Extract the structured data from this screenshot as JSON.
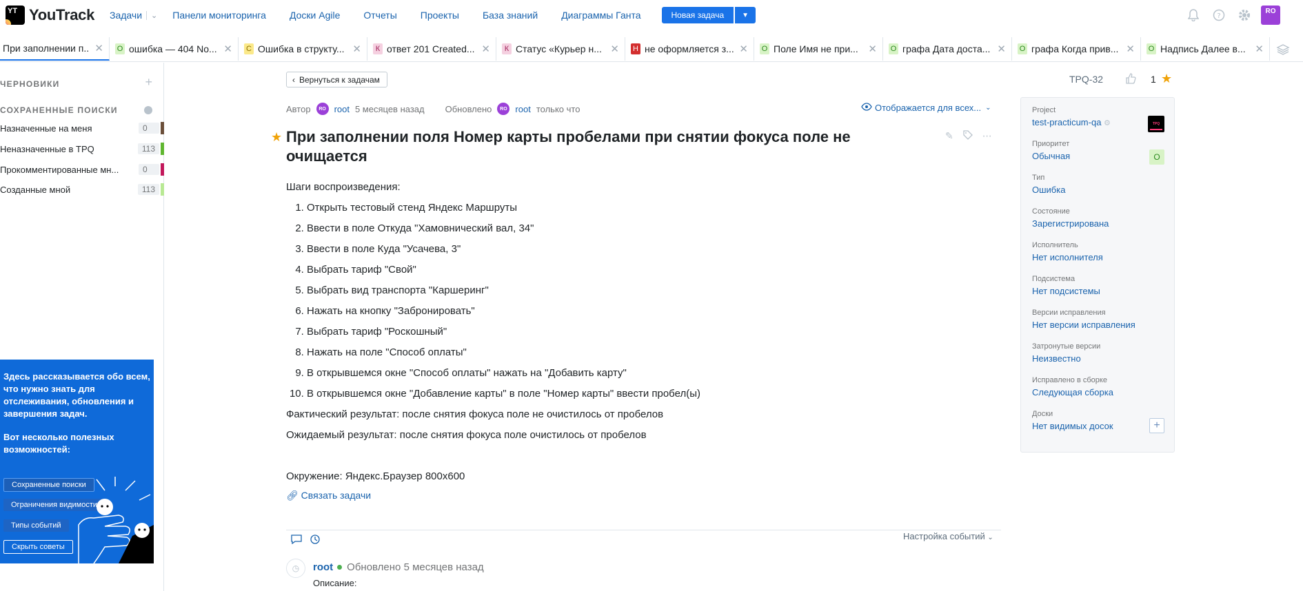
{
  "header": {
    "brand": "YouTrack",
    "logo_text": "YT",
    "nav": [
      "Задачи",
      "Панели мониторинга",
      "Доски Agile",
      "Отчеты",
      "Проекты",
      "База знаний",
      "Диаграммы Ганта"
    ],
    "new_issue": "Новая задача",
    "avatar": "RO"
  },
  "tabs": [
    {
      "type": "",
      "type_color": "",
      "label": "При заполнении п..."
    },
    {
      "type": "О",
      "type_color": "#d8f3c6",
      "label": "ошибка — 404 No..."
    },
    {
      "type": "С",
      "type_color": "#fbe98a",
      "label": "Ошибка в структу..."
    },
    {
      "type": "К",
      "type_color": "#f5d0e0",
      "label": "ответ 201 Created..."
    },
    {
      "type": "К",
      "type_color": "#f5d0e0",
      "label": "Статус «Курьер н..."
    },
    {
      "type": "Н",
      "type_color": "#d32f2f",
      "label": "не оформляется з..."
    },
    {
      "type": "О",
      "type_color": "#d8f3c6",
      "label": "Поле Имя не при..."
    },
    {
      "type": "О",
      "type_color": "#d8f3c6",
      "label": "графа Дата доста..."
    },
    {
      "type": "О",
      "type_color": "#d8f3c6",
      "label": "графа Когда прив..."
    },
    {
      "type": "О",
      "type_color": "#d8f3c6",
      "label": "Надпись Далее в..."
    }
  ],
  "sidebar": {
    "drafts": "ЧЕРНОВИКИ",
    "saved_searches": "СОХРАНЕННЫЕ ПОИСКИ",
    "items": [
      {
        "label": "Назначенные на меня",
        "count": "0",
        "color": "#6b4f3a"
      },
      {
        "label": "Неназначенные в TPQ",
        "count": "113",
        "color": "#5fb630"
      },
      {
        "label": "Прокомментированные мн...",
        "count": "0",
        "color": "#c2185b"
      },
      {
        "label": "Созданные мной",
        "count": "113",
        "color": "#b8e994"
      }
    ],
    "tips": {
      "text1": "Здесь рассказывается обо всем, что нужно знать для отслеживания, обновления и завершения задач.",
      "text2": "Вот несколько полезных возможностей:",
      "buttons": [
        "Сохраненные поиски",
        "Ограничения видимости",
        "Типы событий"
      ],
      "hide": "Скрыть советы"
    }
  },
  "issue": {
    "back": "Вернуться к задачам",
    "id": "TPQ-32",
    "star_count": "1",
    "author_label": "Автор",
    "author_avatar": "RO",
    "author": "root",
    "created": "5 месяцев назад",
    "updated_label": "Обновлено",
    "updater": "root",
    "updated": "только что",
    "visibility": "Отображается для всех...",
    "title": "При заполнении поля Номер карты пробелами при снятии фокуса поле не очищается",
    "steps_header": "Шаги воспроизведения:",
    "steps": [
      "Открыть тестовый стенд Яндекс Маршруты",
      "Ввести в поле Откуда \"Хамовнический вал, 34\"",
      "Ввести в поле Куда \"Усачева, 3\"",
      "Выбрать тариф \"Свой\"",
      "Выбрать вид транспорта \"Каршеринг\"",
      "Нажать на кнопку \"Забронировать\"",
      "Выбрать тариф \"Роскошный\"",
      "Нажать на поле \"Способ оплаты\"",
      "В открывшемся окне \"Способ оплаты\" нажать на \"Добавить карту\"",
      "В открывшемся окне \"Добавление карты\" в поле \"Номер карты\" ввести пробел(ы)"
    ],
    "actual": "Фактический результат: после снятия фокуса поле не очистилось от пробелов",
    "expected": "Ожидаемый результат: после снятия фокуса поле очистилось от пробелов",
    "environment": "Окружение: Яндекс.Браузер 800x600",
    "link_issues": "Связать задачи",
    "activity_settings": "Настройка событий",
    "comment_author": "root",
    "comment_time": "Обновлено 5 месяцев назад",
    "comment_body": "Описание:"
  },
  "fields": [
    {
      "label": "Project",
      "value": "test-practicum-qa"
    },
    {
      "label": "Приоритет",
      "value": "Обычная"
    },
    {
      "label": "Тип",
      "value": "Ошибка"
    },
    {
      "label": "Состояние",
      "value": "Зарегистрирована"
    },
    {
      "label": "Исполнитель",
      "value": "Нет исполнителя"
    },
    {
      "label": "Подсистема",
      "value": "Нет подсистемы"
    },
    {
      "label": "Версии исправления",
      "value": "Нет версии исправления"
    },
    {
      "label": "Затронутые версии",
      "value": "Неизвестно"
    },
    {
      "label": "Исправлено в сборке",
      "value": "Следующая сборка"
    },
    {
      "label": "Доски",
      "value": "Нет видимых досок"
    }
  ],
  "project_icon": "TPQ",
  "priority_badge": "О"
}
